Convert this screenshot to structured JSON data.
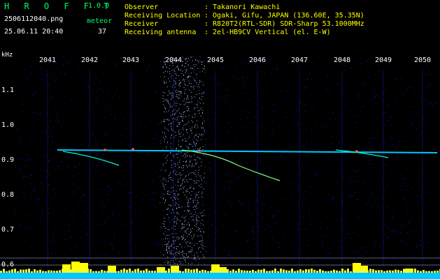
{
  "header": {
    "app_title": "H R O F F T",
    "version": "1.0.0",
    "filename": "2506112040.png",
    "timestamp": "25.06.11 20:40",
    "meteor_label": "meteor",
    "meteor_count": "37"
  },
  "info": {
    "observer_label": "Observer",
    "observer_value": ": Takanori Kawachi",
    "location_label": "Receiving Location",
    "location_value": ": Ogaki, Gifu, JAPAN (136.60E, 35.35N)",
    "receiver_label": "Receiver",
    "receiver_value": ": R820T2(RTL-SDR) SDR-Sharp 53.1000MHz",
    "antenna_label": "Receiving antenna",
    "antenna_value": ": 2el-HB9CV Vertical (el. E-W)"
  },
  "axis": {
    "y_unit": "kHz",
    "x_ticks": [
      "2041",
      "2042",
      "2043",
      "2044",
      "2045",
      "2046",
      "2047",
      "2048",
      "2049",
      "2050"
    ],
    "y_ticks": [
      "1.1",
      "1.0",
      "0.9",
      "0.8",
      "0.7",
      "0.6"
    ]
  },
  "colors": {
    "background": "#000000",
    "noise": "#0a14c8",
    "trace": "#00d0ff",
    "meteor": "#ffff00",
    "baseline": "#00c8ff"
  }
}
